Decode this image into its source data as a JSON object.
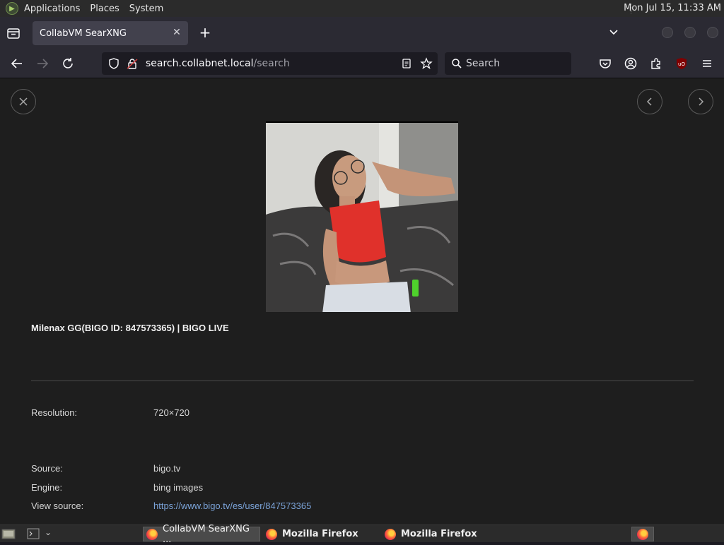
{
  "system_panel": {
    "menus": [
      "Applications",
      "Places",
      "System"
    ],
    "clock": "Mon Jul 15, 11:33 AM"
  },
  "browser": {
    "tab_title": "CollabVM SearXNG",
    "url_host": "search.collabnet.local",
    "url_path": "/search",
    "search_placeholder": "Search"
  },
  "result": {
    "title": "Milenax GG(BIGO ID: 847573365) | BIGO LIVE",
    "resolution_label": "Resolution:",
    "resolution_value": "720×720",
    "source_label": "Source:",
    "source_value": "bigo.tv",
    "engine_label": "Engine:",
    "engine_value": "bing images",
    "view_source_label": "View source:",
    "view_source_value": "https://www.bigo.tv/es/user/847573365"
  },
  "taskbar": {
    "tasks": [
      "CollabVM SearXNG ...",
      "Mozilla Firefox",
      "Mozilla Firefox"
    ]
  },
  "colors": {
    "page_bg": "#1e1e1e",
    "chrome_bg": "#2b2a33",
    "link": "#7ba3d8"
  }
}
